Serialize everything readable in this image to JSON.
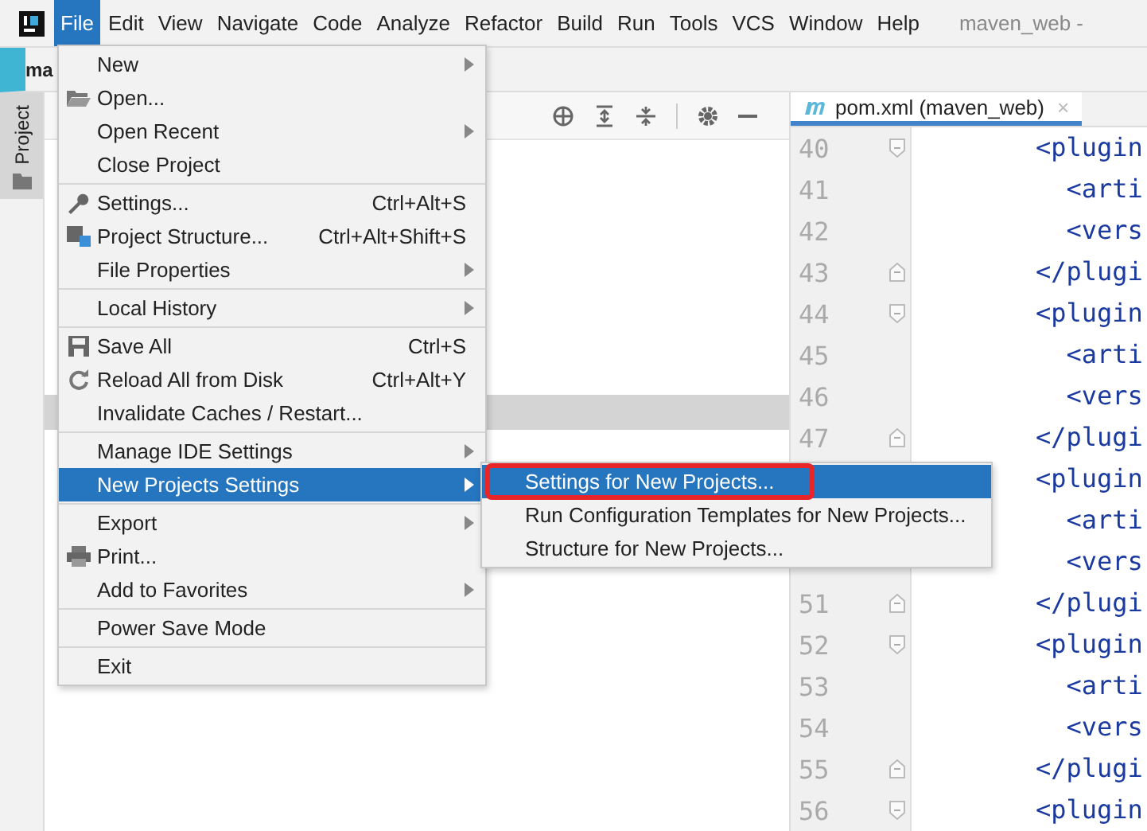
{
  "menubar": {
    "items": [
      {
        "label": "File",
        "selected": true
      },
      {
        "label": "Edit",
        "selected": false
      },
      {
        "label": "View",
        "selected": false
      },
      {
        "label": "Navigate",
        "selected": false
      },
      {
        "label": "Code",
        "selected": false
      },
      {
        "label": "Analyze",
        "selected": false
      },
      {
        "label": "Refactor",
        "selected": false
      },
      {
        "label": "Build",
        "selected": false
      },
      {
        "label": "Run",
        "selected": false
      },
      {
        "label": "Tools",
        "selected": false
      },
      {
        "label": "VCS",
        "selected": false
      },
      {
        "label": "Window",
        "selected": false
      },
      {
        "label": "Help",
        "selected": false
      }
    ],
    "title": "maven_web -"
  },
  "navbar": {
    "crumb": "ma"
  },
  "sidebar": {
    "tab": "Project"
  },
  "editor": {
    "tab": {
      "label": "pom.xml (maven_web)",
      "close": "×"
    },
    "lines": [
      {
        "number": "40",
        "text": "<plugin",
        "kind": "fold-start"
      },
      {
        "number": "41",
        "text": "  <arti"
      },
      {
        "number": "42",
        "text": "  <vers"
      },
      {
        "number": "43",
        "text": "</plugi",
        "kind": "fold-end"
      },
      {
        "number": "44",
        "text": "<plugin",
        "kind": "fold-start"
      },
      {
        "number": "45",
        "text": "  <arti"
      },
      {
        "number": "46",
        "text": "  <vers"
      },
      {
        "number": "47",
        "text": "</plugi",
        "kind": "fold-end"
      },
      {
        "text": "<plugin"
      },
      {
        "text": "  <arti"
      },
      {
        "text": "  <vers"
      },
      {
        "number": "51",
        "text": "</plugi",
        "kind": "fold-end"
      },
      {
        "number": "52",
        "text": "<plugin",
        "kind": "fold-start"
      },
      {
        "number": "53",
        "text": "  <arti"
      },
      {
        "number": "54",
        "text": "  <vers"
      },
      {
        "number": "55",
        "text": "</plugi",
        "kind": "fold-end"
      },
      {
        "number": "56",
        "text": "<plugin",
        "kind": "fold-start"
      }
    ]
  },
  "file_menu": {
    "items": [
      {
        "kind": "item",
        "label": "New",
        "submenu": true,
        "selected": false
      },
      {
        "kind": "folder",
        "label": "Open...",
        "selected": false
      },
      {
        "kind": "item",
        "label": "Open Recent",
        "submenu": true,
        "selected": false
      },
      {
        "kind": "item",
        "label": "Close Project",
        "selected": false
      },
      {
        "kind": "separator"
      },
      {
        "kind": "wrench",
        "label": "Settings...",
        "shortcut": "Ctrl+Alt+S",
        "selected": false
      },
      {
        "kind": "structure",
        "label": "Project Structure...",
        "shortcut": "Ctrl+Alt+Shift+S",
        "selected": false
      },
      {
        "kind": "item",
        "label": "File Properties",
        "submenu": true,
        "selected": false
      },
      {
        "kind": "separator"
      },
      {
        "kind": "item",
        "label": "Local History",
        "submenu": true,
        "selected": false
      },
      {
        "kind": "separator"
      },
      {
        "kind": "save",
        "label": "Save All",
        "shortcut": "Ctrl+S",
        "selected": false
      },
      {
        "kind": "reload",
        "label": "Reload All from Disk",
        "shortcut": "Ctrl+Alt+Y",
        "selected": false
      },
      {
        "kind": "item",
        "label": "Invalidate Caches / Restart...",
        "selected": false
      },
      {
        "kind": "separator"
      },
      {
        "kind": "item",
        "label": "Manage IDE Settings",
        "submenu": true,
        "selected": false
      },
      {
        "kind": "item",
        "label": "New Projects Settings",
        "submenu": true,
        "selected": true
      },
      {
        "kind": "separator"
      },
      {
        "kind": "item",
        "label": "Export",
        "submenu": true,
        "selected": false
      },
      {
        "kind": "print",
        "label": "Print...",
        "selected": false
      },
      {
        "kind": "item",
        "label": "Add to Favorites",
        "submenu": true,
        "selected": false
      },
      {
        "kind": "separator"
      },
      {
        "kind": "item",
        "label": "Power Save Mode",
        "selected": false
      },
      {
        "kind": "separator"
      },
      {
        "kind": "item",
        "label": "Exit",
        "selected": false
      }
    ]
  },
  "submenu": {
    "items": [
      {
        "label": "Settings for New Projects...",
        "selected": true,
        "outlined": true
      },
      {
        "label": "Run Configuration Templates for New Projects...",
        "selected": false,
        "outlined": false
      },
      {
        "label": "Structure for New Projects...",
        "selected": false,
        "outlined": false
      }
    ]
  }
}
